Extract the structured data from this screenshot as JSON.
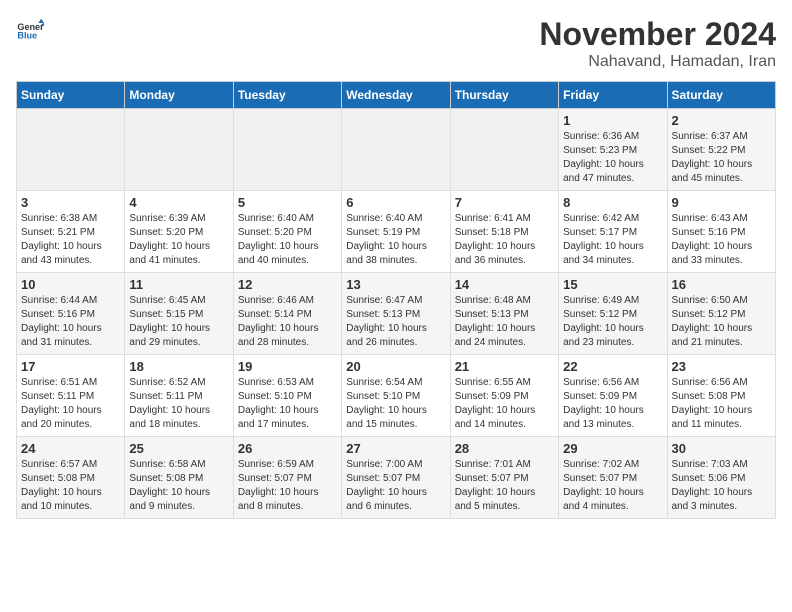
{
  "logo": {
    "general": "General",
    "blue": "Blue"
  },
  "title": "November 2024",
  "subtitle": "Nahavand, Hamadan, Iran",
  "weekdays": [
    "Sunday",
    "Monday",
    "Tuesday",
    "Wednesday",
    "Thursday",
    "Friday",
    "Saturday"
  ],
  "weeks": [
    [
      {
        "day": "",
        "info": ""
      },
      {
        "day": "",
        "info": ""
      },
      {
        "day": "",
        "info": ""
      },
      {
        "day": "",
        "info": ""
      },
      {
        "day": "",
        "info": ""
      },
      {
        "day": "1",
        "info": "Sunrise: 6:36 AM\nSunset: 5:23 PM\nDaylight: 10 hours\nand 47 minutes."
      },
      {
        "day": "2",
        "info": "Sunrise: 6:37 AM\nSunset: 5:22 PM\nDaylight: 10 hours\nand 45 minutes."
      }
    ],
    [
      {
        "day": "3",
        "info": "Sunrise: 6:38 AM\nSunset: 5:21 PM\nDaylight: 10 hours\nand 43 minutes."
      },
      {
        "day": "4",
        "info": "Sunrise: 6:39 AM\nSunset: 5:20 PM\nDaylight: 10 hours\nand 41 minutes."
      },
      {
        "day": "5",
        "info": "Sunrise: 6:40 AM\nSunset: 5:20 PM\nDaylight: 10 hours\nand 40 minutes."
      },
      {
        "day": "6",
        "info": "Sunrise: 6:40 AM\nSunset: 5:19 PM\nDaylight: 10 hours\nand 38 minutes."
      },
      {
        "day": "7",
        "info": "Sunrise: 6:41 AM\nSunset: 5:18 PM\nDaylight: 10 hours\nand 36 minutes."
      },
      {
        "day": "8",
        "info": "Sunrise: 6:42 AM\nSunset: 5:17 PM\nDaylight: 10 hours\nand 34 minutes."
      },
      {
        "day": "9",
        "info": "Sunrise: 6:43 AM\nSunset: 5:16 PM\nDaylight: 10 hours\nand 33 minutes."
      }
    ],
    [
      {
        "day": "10",
        "info": "Sunrise: 6:44 AM\nSunset: 5:16 PM\nDaylight: 10 hours\nand 31 minutes."
      },
      {
        "day": "11",
        "info": "Sunrise: 6:45 AM\nSunset: 5:15 PM\nDaylight: 10 hours\nand 29 minutes."
      },
      {
        "day": "12",
        "info": "Sunrise: 6:46 AM\nSunset: 5:14 PM\nDaylight: 10 hours\nand 28 minutes."
      },
      {
        "day": "13",
        "info": "Sunrise: 6:47 AM\nSunset: 5:13 PM\nDaylight: 10 hours\nand 26 minutes."
      },
      {
        "day": "14",
        "info": "Sunrise: 6:48 AM\nSunset: 5:13 PM\nDaylight: 10 hours\nand 24 minutes."
      },
      {
        "day": "15",
        "info": "Sunrise: 6:49 AM\nSunset: 5:12 PM\nDaylight: 10 hours\nand 23 minutes."
      },
      {
        "day": "16",
        "info": "Sunrise: 6:50 AM\nSunset: 5:12 PM\nDaylight: 10 hours\nand 21 minutes."
      }
    ],
    [
      {
        "day": "17",
        "info": "Sunrise: 6:51 AM\nSunset: 5:11 PM\nDaylight: 10 hours\nand 20 minutes."
      },
      {
        "day": "18",
        "info": "Sunrise: 6:52 AM\nSunset: 5:11 PM\nDaylight: 10 hours\nand 18 minutes."
      },
      {
        "day": "19",
        "info": "Sunrise: 6:53 AM\nSunset: 5:10 PM\nDaylight: 10 hours\nand 17 minutes."
      },
      {
        "day": "20",
        "info": "Sunrise: 6:54 AM\nSunset: 5:10 PM\nDaylight: 10 hours\nand 15 minutes."
      },
      {
        "day": "21",
        "info": "Sunrise: 6:55 AM\nSunset: 5:09 PM\nDaylight: 10 hours\nand 14 minutes."
      },
      {
        "day": "22",
        "info": "Sunrise: 6:56 AM\nSunset: 5:09 PM\nDaylight: 10 hours\nand 13 minutes."
      },
      {
        "day": "23",
        "info": "Sunrise: 6:56 AM\nSunset: 5:08 PM\nDaylight: 10 hours\nand 11 minutes."
      }
    ],
    [
      {
        "day": "24",
        "info": "Sunrise: 6:57 AM\nSunset: 5:08 PM\nDaylight: 10 hours\nand 10 minutes."
      },
      {
        "day": "25",
        "info": "Sunrise: 6:58 AM\nSunset: 5:08 PM\nDaylight: 10 hours\nand 9 minutes."
      },
      {
        "day": "26",
        "info": "Sunrise: 6:59 AM\nSunset: 5:07 PM\nDaylight: 10 hours\nand 8 minutes."
      },
      {
        "day": "27",
        "info": "Sunrise: 7:00 AM\nSunset: 5:07 PM\nDaylight: 10 hours\nand 6 minutes."
      },
      {
        "day": "28",
        "info": "Sunrise: 7:01 AM\nSunset: 5:07 PM\nDaylight: 10 hours\nand 5 minutes."
      },
      {
        "day": "29",
        "info": "Sunrise: 7:02 AM\nSunset: 5:07 PM\nDaylight: 10 hours\nand 4 minutes."
      },
      {
        "day": "30",
        "info": "Sunrise: 7:03 AM\nSunset: 5:06 PM\nDaylight: 10 hours\nand 3 minutes."
      }
    ]
  ]
}
